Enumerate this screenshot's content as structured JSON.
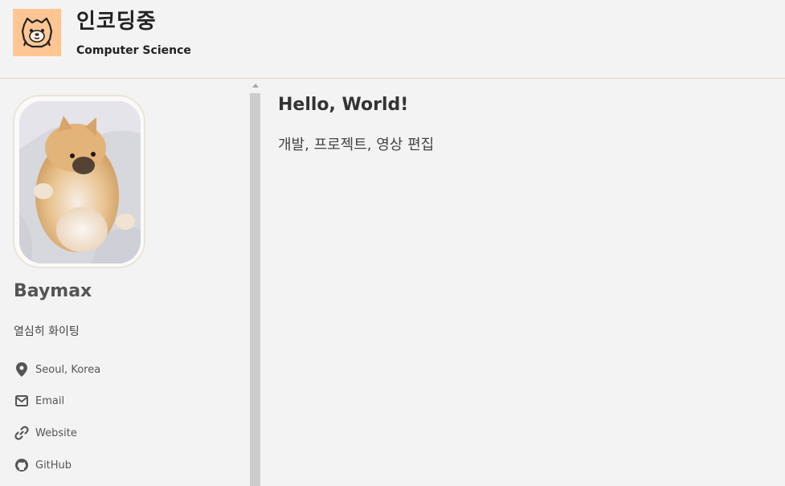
{
  "header": {
    "title": "인코딩중",
    "subtitle": "Computer Science",
    "logo_icon": "dog-face-icon",
    "logo_bg": "#ffc694"
  },
  "sidebar": {
    "photo_alt": "Pomeranian dog profile photo",
    "name": "Baymax",
    "bio": "열심히 화이팅",
    "links": [
      {
        "icon": "map-marker-icon",
        "label": "Seoul, Korea"
      },
      {
        "icon": "envelope-icon",
        "label": "Email"
      },
      {
        "icon": "link-icon",
        "label": "Website"
      },
      {
        "icon": "github-icon",
        "label": "GitHub"
      }
    ]
  },
  "main": {
    "heading": "Hello, World!",
    "text": "개발, 프로젝트, 영상 편집"
  },
  "colors": {
    "background": "#f3f3f3",
    "header_border": "#e6d2c4",
    "scrollbar_thumb": "#cdcdcd"
  }
}
